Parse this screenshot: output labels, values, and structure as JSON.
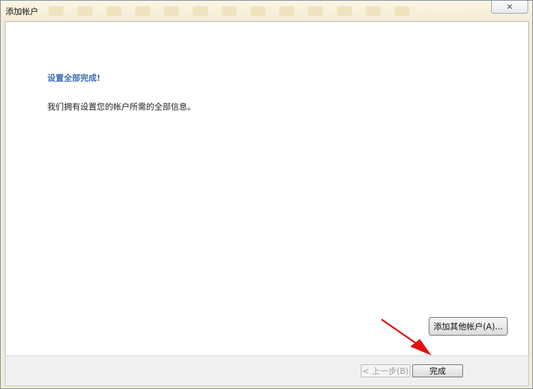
{
  "window": {
    "title": "添加帐户",
    "close_icon": "✕"
  },
  "main": {
    "heading": "设置全部完成!",
    "message": "我们拥有设置您的帐户所需的全部信息。",
    "add_other_account_label": "添加其他帐户(A)..."
  },
  "footer": {
    "prev_label": "< 上一步(B)",
    "finish_label": "完成"
  },
  "annotation": {
    "arrow_color": "#e01010",
    "arrow_icon": "red-arrow-icon"
  }
}
